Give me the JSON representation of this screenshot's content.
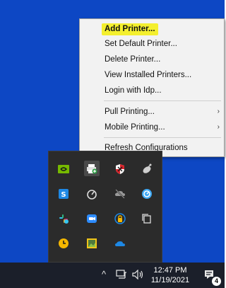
{
  "context_menu": {
    "items": [
      {
        "label": "Add Printer...",
        "highlighted": true
      },
      {
        "label": "Set Default Printer..."
      },
      {
        "label": "Delete Printer..."
      },
      {
        "label": "View Installed Printers..."
      },
      {
        "label": "Login with Idp..."
      },
      {
        "label": "Pull Printing...",
        "submenu": true
      },
      {
        "label": "Mobile Printing...",
        "submenu": true
      },
      {
        "label": "Refresh Configurations"
      }
    ],
    "submenu_arrow": "›",
    "highlight_color": "#f4ef2e"
  },
  "tray_overflow": {
    "icons": [
      {
        "name": "nvidia-icon",
        "color": "#76b900"
      },
      {
        "name": "printer-add-icon",
        "color": "#ffffff"
      },
      {
        "name": "shield-x-icon",
        "color": "#d9242b"
      },
      {
        "name": "satellite-icon",
        "color": "#cfcfcf"
      },
      {
        "name": "s-app-icon",
        "color": "#1e88e5"
      },
      {
        "name": "gauge-icon",
        "color": "#dcdcdc"
      },
      {
        "name": "muted-cloud-icon",
        "color": "#9a9a9a"
      },
      {
        "name": "sync-circle-icon",
        "color": "#3fa9f5"
      },
      {
        "name": "slack-icon",
        "color": "#36c5f0"
      },
      {
        "name": "zoom-icon",
        "color": "#2d8cff"
      },
      {
        "name": "security-lock-icon",
        "color": "#f5b700"
      },
      {
        "name": "copy-icon",
        "color": "#dcdcdc"
      },
      {
        "name": "clock-app-icon",
        "color": "#f5b700"
      },
      {
        "name": "image-app-icon",
        "color": "#f0c419"
      },
      {
        "name": "cloud-icon",
        "color": "#1e88e5"
      }
    ]
  },
  "taskbar": {
    "show_hidden_icon": "^",
    "network_icon": "network-icon",
    "volume_icon": "volume-icon",
    "time": "12:47 PM",
    "date": "11/19/2021",
    "notification_count": "4"
  }
}
